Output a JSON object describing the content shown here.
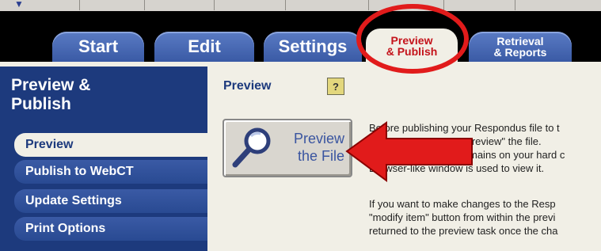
{
  "tabs": [
    {
      "label": "Start"
    },
    {
      "label": "Edit"
    },
    {
      "label": "Settings"
    },
    {
      "label_line1": "Preview",
      "label_line2": "& Publish",
      "active": true
    },
    {
      "label_line1": "Retrieval",
      "label_line2": "& Reports"
    }
  ],
  "sidebar": {
    "title_line1": "Preview &",
    "title_line2": "Publish",
    "items": [
      {
        "label": "Preview",
        "active": true
      },
      {
        "label": "Publish to WebCT"
      },
      {
        "label": "Update Settings"
      },
      {
        "label": "Print Options"
      }
    ]
  },
  "main": {
    "title": "Preview",
    "help_label": "?",
    "preview_button": {
      "line1": "Preview",
      "line2": "the File"
    },
    "description_lines": [
      "Before publishing your Respondus file to t",
      "\"preview\" the file.",
      "mains on your hard c",
      "Browser-like window is used to view it.",
      "If you want to make changes to the Resp",
      "\"modify item\" button from within the previ",
      "returned to the preview task once the cha"
    ]
  },
  "colors": {
    "annotation_red": "#e11b1b",
    "nav_blue": "#1d3a7d",
    "active_tab_text": "#c4131b",
    "panel_bg": "#f1efe6"
  },
  "icons": {
    "preview_button_icon": "magnifying-glass-icon",
    "annotation_arrow": "red-arrow-left",
    "annotation_circle": "red-ellipse-highlight"
  }
}
